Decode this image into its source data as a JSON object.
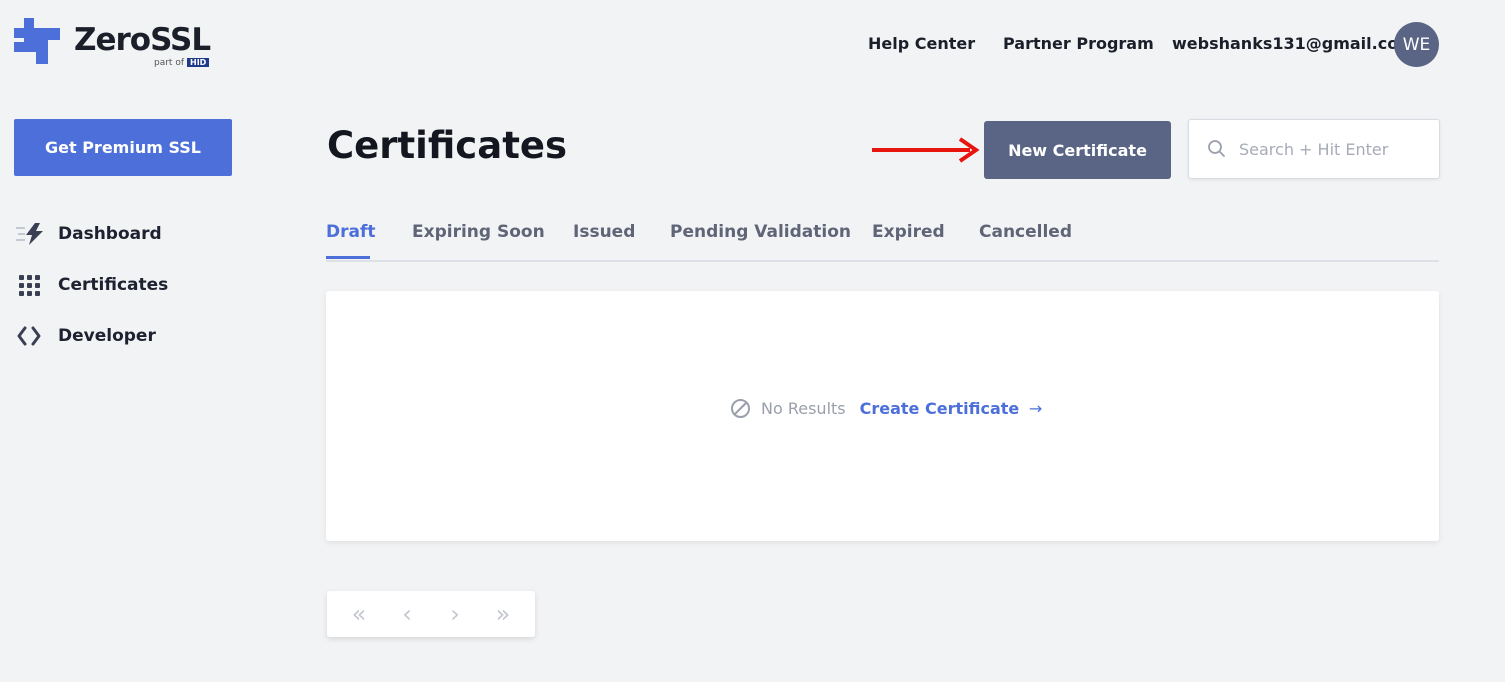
{
  "brand": {
    "name": "ZeroSSL",
    "sub": "part of",
    "parent": "HID",
    "accent": "#4d6fd9"
  },
  "topnav": {
    "help": "Help Center",
    "partner": "Partner Program",
    "email": "webshanks131@gmail.com",
    "avatar_initials": "WE"
  },
  "sidebar": {
    "premium_button": "Get Premium SSL",
    "items": [
      {
        "label": "Dashboard",
        "icon": "lightning-icon"
      },
      {
        "label": "Certificates",
        "icon": "grid-dots-icon"
      },
      {
        "label": "Developer",
        "icon": "code-icon"
      }
    ]
  },
  "main": {
    "title": "Certificates",
    "new_button": "New Certificate",
    "search_placeholder": "Search + Hit Enter",
    "tabs": [
      {
        "label": "Draft",
        "active": true
      },
      {
        "label": "Expiring Soon"
      },
      {
        "label": "Issued"
      },
      {
        "label": "Pending Validation"
      },
      {
        "label": "Expired"
      },
      {
        "label": "Cancelled"
      }
    ],
    "empty": {
      "text": "No Results",
      "link": "Create Certificate",
      "arrow": "→"
    },
    "pager": [
      "«",
      "‹",
      "›",
      "»"
    ]
  },
  "colors": {
    "annotation_arrow": "#e8140e",
    "button_dark": "#5a6585"
  }
}
